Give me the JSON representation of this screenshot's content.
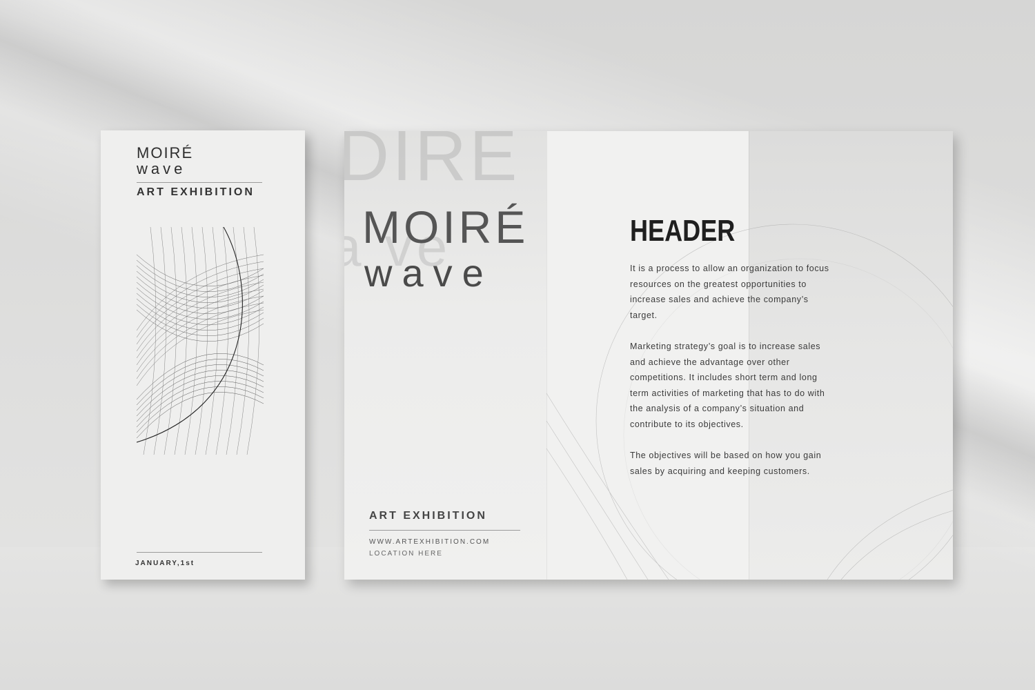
{
  "flyer": {
    "logo_line1": "MOIRÉ",
    "logo_line2": "wave",
    "title": "ART EXHIBITION",
    "date": "JANUARY,1st",
    "art_icon": "moire-wave-pattern-icon"
  },
  "brochure": {
    "ghost_line1": "DIRE",
    "ghost_line2": "a ve",
    "logo_line1": "MOIRÉ",
    "logo_line2": "wave",
    "title": "ART EXHIBITION",
    "website": "WWW.ARTEXHIBITION.COM",
    "location": "LOCATION HERE",
    "header": "HEADER",
    "paragraphs": [
      "It is a process to allow an organization to focus resources on the greatest opportunities to increase sales and achieve the company’s target.",
      "Marketing strategy’s goal is to increase sales and achieve the advantage over other competitions. It includes short term and long term activities of marketing that has to do with the analysis of a company’s situation and contribute to its objectives.",
      "The objectives will be based on how you gain sales by acquiring and keeping customers."
    ]
  },
  "colors": {
    "paper": "#efefee",
    "ink": "#2e2e2e",
    "wall": "#dcdcdb"
  }
}
